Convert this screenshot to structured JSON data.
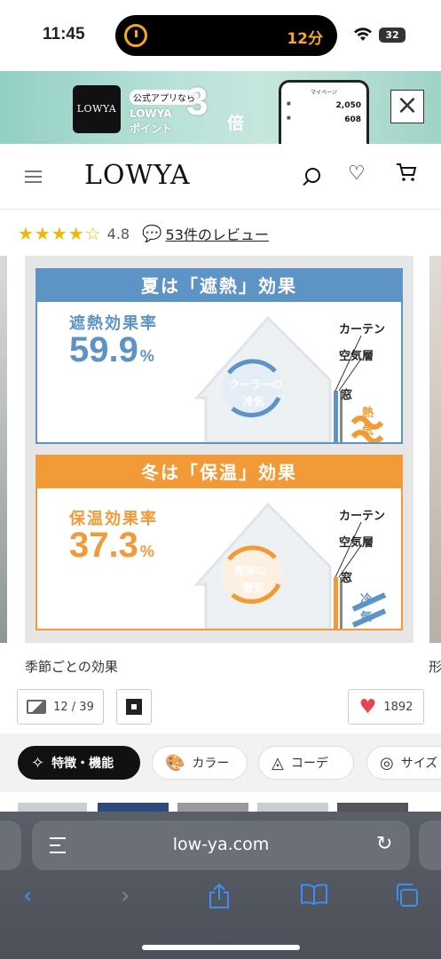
{
  "status_bar": {
    "time": "11:45",
    "timer": "12分",
    "battery": "32"
  },
  "banner": {
    "logo": "LOWYA",
    "app_tag": "公式アプリなら",
    "points_line1": "LOWYA",
    "points_line2": "ポイント",
    "multiplier": "3",
    "multiplier_unit": "倍",
    "phone_title": "マイページ",
    "phone_value1": "2,050",
    "phone_value2": "608",
    "close": "×"
  },
  "header": {
    "logo": "LOWYA"
  },
  "rating": {
    "stars": "★★★★☆",
    "score": "4.8",
    "reviews_link": "53件のレビュー"
  },
  "slide": {
    "summer": {
      "heading": "夏は「遮熱」効果",
      "rate_label": "遮熱効果率",
      "rate_value": "59.9",
      "rate_unit": "%",
      "center_line1": "クーラーの",
      "center_line2": "冷気",
      "label_curtain": "カーテン",
      "label_air": "空気層",
      "label_window": "窓",
      "label_outside1": "熱",
      "label_outside2": "気"
    },
    "winter": {
      "heading": "冬は「保温」効果",
      "rate_label": "保温効果率",
      "rate_value": "37.3",
      "rate_unit": "%",
      "center_line1": "暖房の",
      "center_line2": "暖気",
      "label_curtain": "カーテン",
      "label_air": "空気層",
      "label_window": "窓",
      "label_outside1": "冷",
      "label_outside2": "気"
    },
    "caption": "季節ごとの効果",
    "next_caption": "形"
  },
  "controls": {
    "image_count": "12 / 39",
    "likes": "1892"
  },
  "tabs": [
    {
      "label": "特徴・機能",
      "icon": "✧"
    },
    {
      "label": "カラー",
      "icon": "🎨"
    },
    {
      "label": "コーデ",
      "icon": "◬"
    },
    {
      "label": "サイズ",
      "icon": "◎"
    }
  ],
  "browser": {
    "url": "low-ya.com"
  },
  "colors": {
    "summer": "#5e93c6",
    "winter": "#f29a37",
    "like": "#e8434f",
    "safari_blue": "#3d8ef5"
  }
}
